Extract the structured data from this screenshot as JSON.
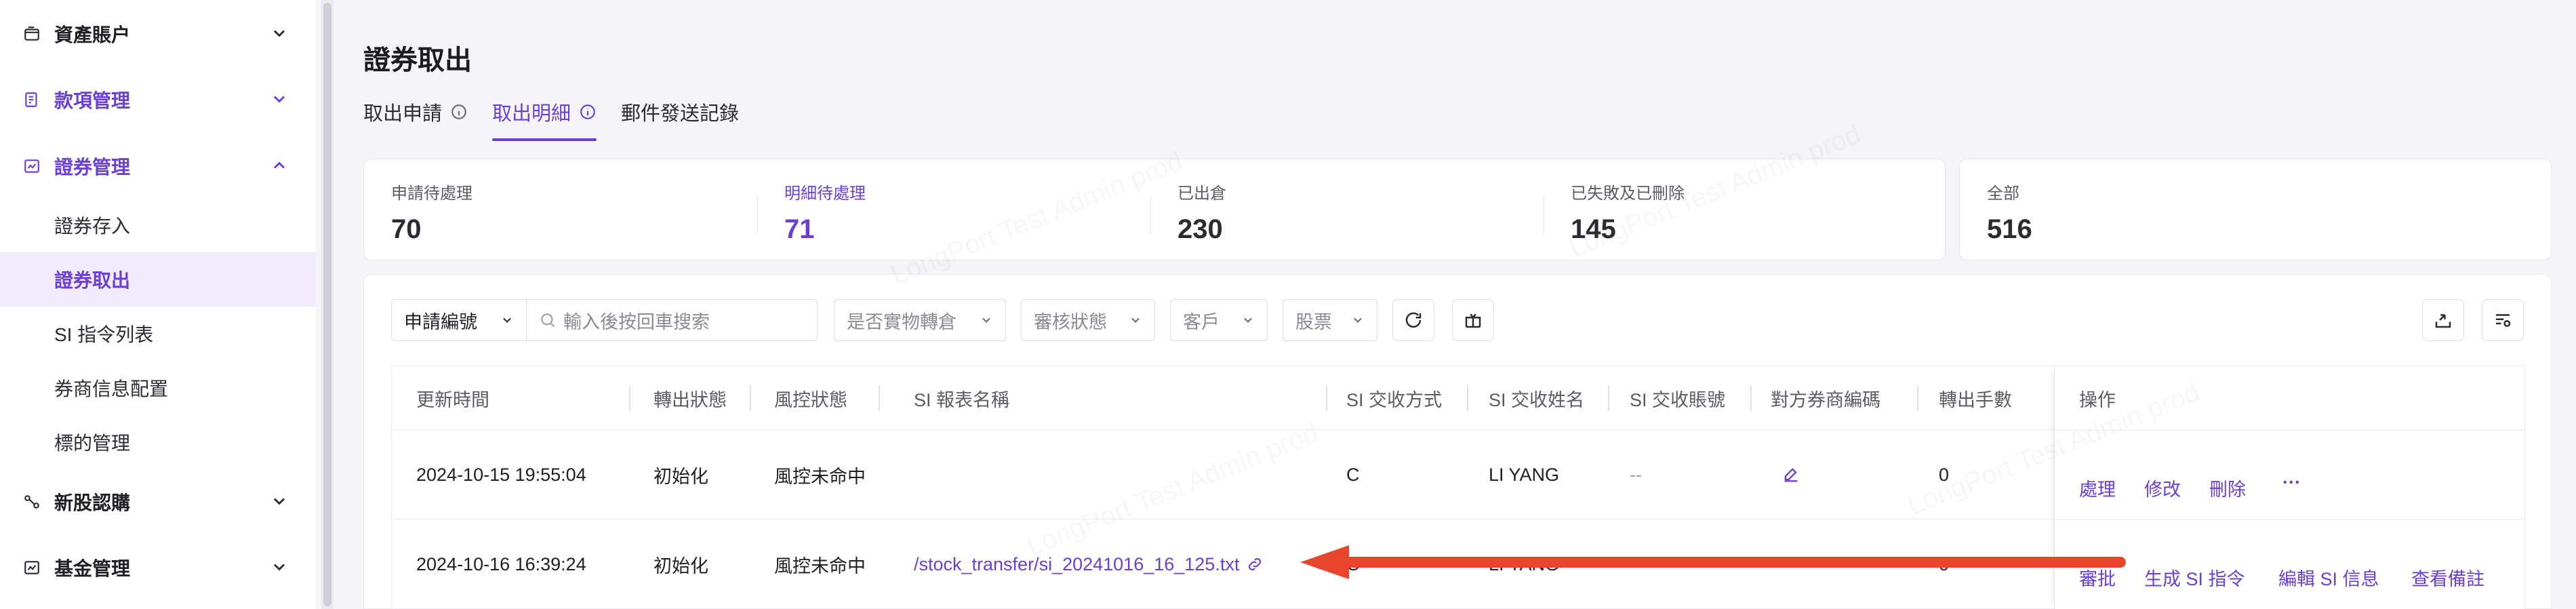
{
  "sidebar": {
    "groups": [
      {
        "label": "資產賬户",
        "icon": "wallet-icon"
      },
      {
        "label": "款項管理",
        "icon": "document-icon"
      },
      {
        "label": "證券管理",
        "icon": "chart-icon"
      },
      {
        "label": "新股認購",
        "icon": "share-icon"
      },
      {
        "label": "基金管理",
        "icon": "chart-icon"
      }
    ],
    "items": [
      "證券存入",
      "證券取出",
      "SI 指令列表",
      "券商信息配置",
      "標的管理"
    ],
    "active_item": "證券取出"
  },
  "page": {
    "title": "證券取出"
  },
  "tabs": [
    {
      "label": "取出申請",
      "info": true
    },
    {
      "label": "取出明細",
      "info": true,
      "active": true
    },
    {
      "label": "郵件發送記錄",
      "info": false
    }
  ],
  "stats": [
    {
      "label": "申請待處理",
      "value": "70"
    },
    {
      "label": "明細待處理",
      "value": "71",
      "active": true
    },
    {
      "label": "已出倉",
      "value": "230"
    },
    {
      "label": "已失敗及已刪除",
      "value": "145"
    },
    {
      "label": "全部",
      "value": "516"
    }
  ],
  "filters": {
    "search_type": "申請編號",
    "search_placeholder": "輸入後按回車搜索",
    "physical": "是否實物轉倉",
    "review": "審核狀態",
    "customer": "客戶",
    "stock": "股票"
  },
  "table": {
    "columns": [
      "更新時間",
      "轉出狀態",
      "風控狀態",
      "SI 報表名稱",
      "SI 交收方式",
      "SI 交收姓名",
      "SI 交收賬號",
      "對方券商編碼",
      "轉出手數",
      "操作"
    ],
    "rows": [
      {
        "time": "2024-10-15 19:55:04",
        "out_status": "初始化",
        "risk": "風控未命中",
        "si_name": "",
        "method": "C",
        "name": "LI YANG",
        "account": "--",
        "fee": "0",
        "ops": [
          "處理",
          "修改",
          "刪除",
          "···"
        ]
      },
      {
        "time": "2024-10-16 16:39:24",
        "out_status": "初始化",
        "risk": "風控未命中",
        "si_name": "/stock_transfer/si_20241016_16_125.txt",
        "method": "C",
        "name": "LI YANG",
        "account": "--",
        "fee": "0",
        "ops": [
          "審批",
          "生成 SI 指令",
          "編輯 SI 信息",
          "查看備註"
        ]
      }
    ]
  },
  "watermark": "LongPort Test Admin prod",
  "colors": {
    "accent": "#6b3fd6",
    "arrow": "#e8462c"
  }
}
